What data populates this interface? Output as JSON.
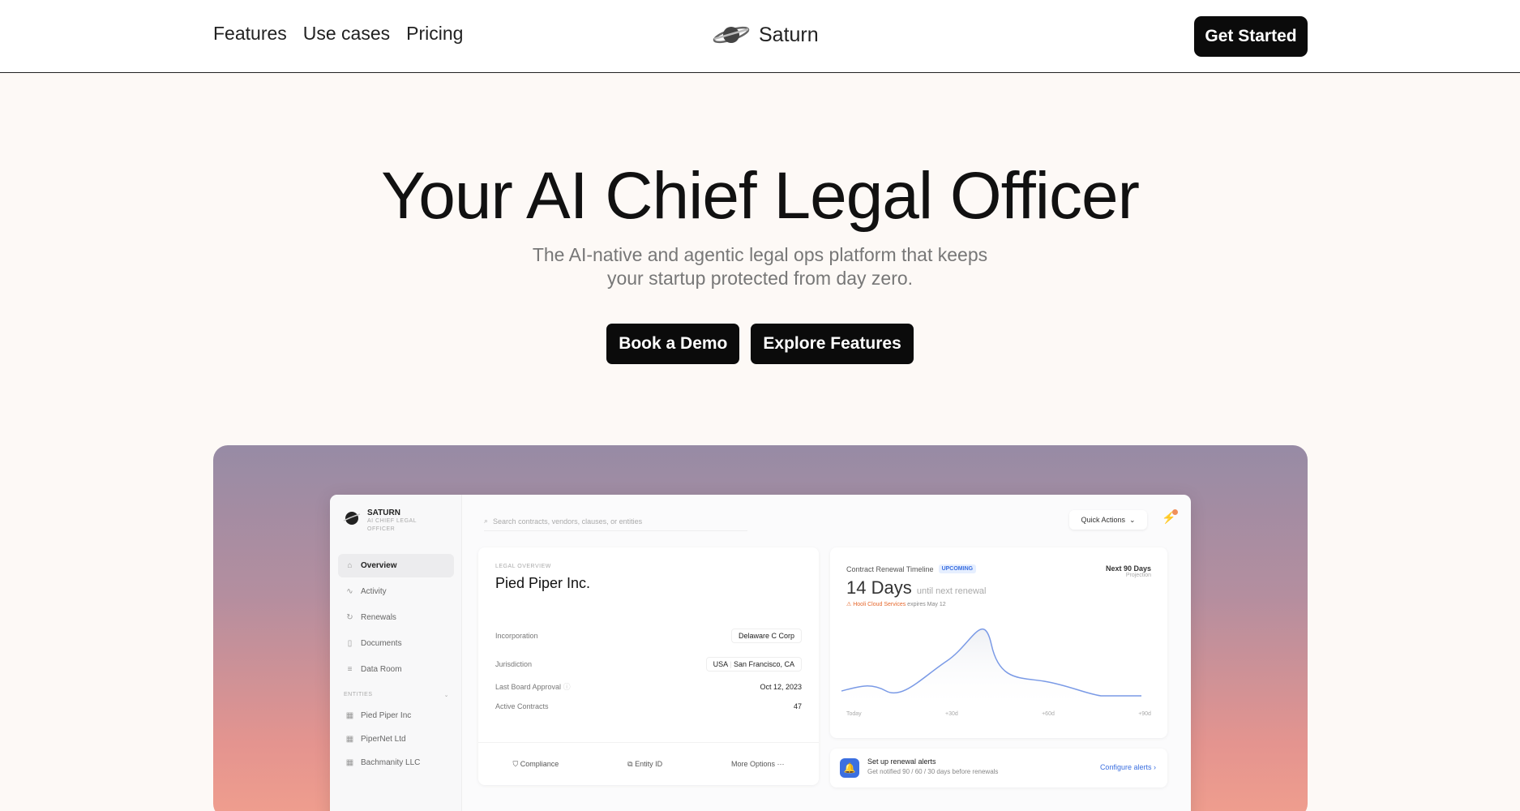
{
  "nav": {
    "links": [
      "Features",
      "Use cases",
      "Pricing"
    ],
    "brand": "Saturn",
    "cta": "Get Started"
  },
  "hero": {
    "title": "Your AI Chief Legal Officer",
    "subtitle_line1": "The AI-native and agentic legal ops platform that keeps",
    "subtitle_line2": "your startup protected from day zero.",
    "btn_demo": "Book a Demo",
    "btn_features": "Explore Features"
  },
  "app": {
    "logo_name": "SATURN",
    "logo_tag": "AI CHIEF LEGAL OFFICER",
    "menu": [
      "Overview",
      "Activity",
      "Renewals",
      "Documents",
      "Data Room"
    ],
    "entities_label": "ENTITIES",
    "entities": [
      "Pied Piper Inc",
      "PiperNet Ltd",
      "Bachmanity LLC"
    ],
    "search_placeholder": "Search contracts, vendors, clauses, or entities",
    "quick_actions": "Quick Actions",
    "overview": {
      "label": "LEGAL OVERVIEW",
      "title": "Pied Piper Inc.",
      "rows": [
        {
          "k": "Incorporation",
          "v": "Delaware C Corp"
        },
        {
          "k": "Jurisdiction",
          "v1": "USA",
          "v2": "San Francisco, CA"
        },
        {
          "k": "Last Board Approval",
          "v": "Oct 12, 2023"
        },
        {
          "k": "Active Contracts",
          "v": "47"
        }
      ],
      "footer": [
        "Compliance",
        "Entity ID",
        "More Options"
      ]
    },
    "renewal": {
      "title": "Contract Renewal Timeline",
      "badge": "UPCOMING",
      "next": "Next 90 Days",
      "projection": "Projection",
      "big": "14 Days",
      "big_suffix": "until next renewal",
      "vendor": "Hooli Cloud Services",
      "expires": "expires May 12",
      "axis": [
        "Today",
        "+30d",
        "+60d",
        "+90d"
      ]
    },
    "alert": {
      "title": "Set up renewal alerts",
      "subtitle": "Get notified 90 / 60 / 30 days before renewals",
      "link": "Configure alerts"
    }
  }
}
